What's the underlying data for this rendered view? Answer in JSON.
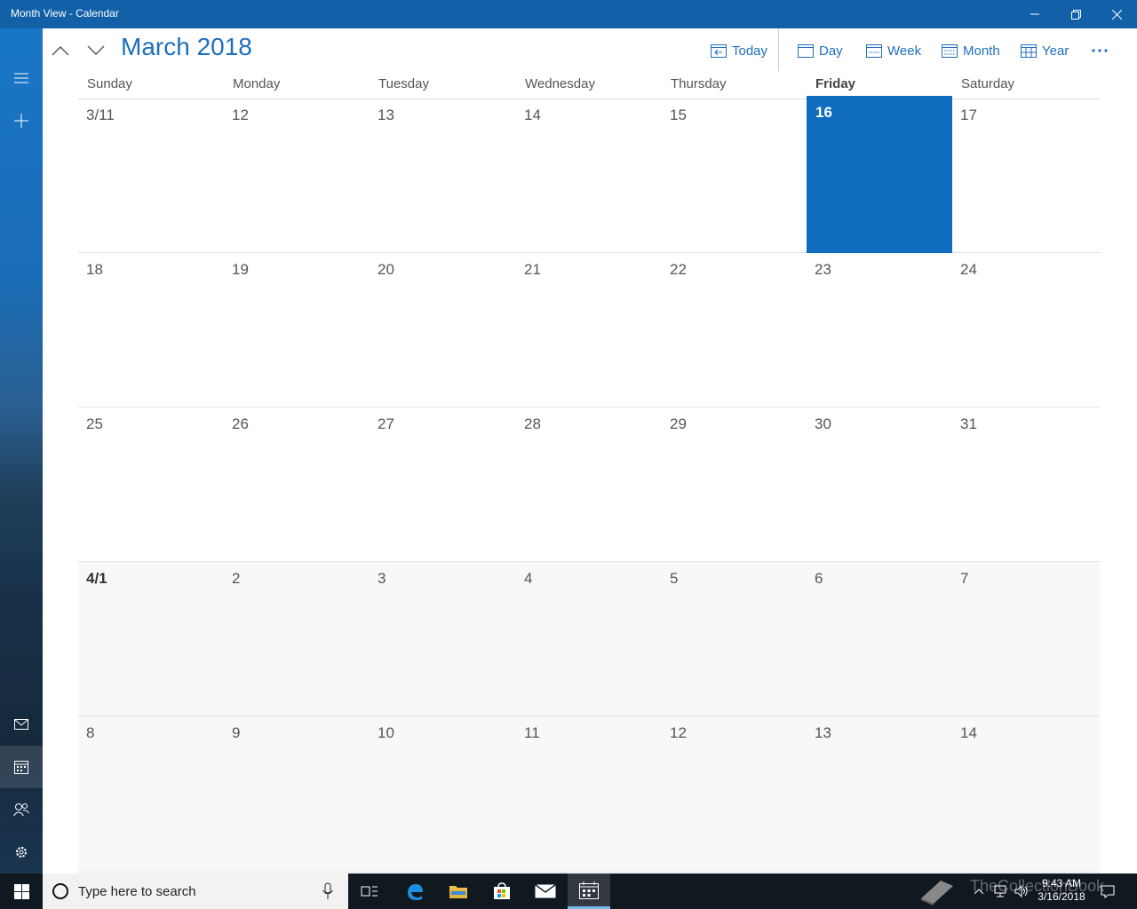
{
  "window": {
    "title": "Month View - Calendar"
  },
  "header": {
    "month_title": "March 2018",
    "views": {
      "today": "Today",
      "day": "Day",
      "week": "Week",
      "month": "Month",
      "year": "Year"
    }
  },
  "weekdays": [
    "Sunday",
    "Monday",
    "Tuesday",
    "Wednesday",
    "Thursday",
    "Friday",
    "Saturday"
  ],
  "today_weekday_index": 5,
  "weeks": [
    [
      "3/11",
      "12",
      "13",
      "14",
      "15",
      "16",
      "17"
    ],
    [
      "18",
      "19",
      "20",
      "21",
      "22",
      "23",
      "24"
    ],
    [
      "25",
      "26",
      "27",
      "28",
      "29",
      "30",
      "31"
    ],
    [
      "4/1",
      "2",
      "3",
      "4",
      "5",
      "6",
      "7"
    ],
    [
      "8",
      "9",
      "10",
      "11",
      "12",
      "13",
      "14"
    ]
  ],
  "today_cell": {
    "week": 0,
    "day": 5
  },
  "next_month_start_week": 3,
  "taskbar": {
    "search_placeholder": "Type here to search",
    "time": "9:43 AM",
    "date": "3/16/2018",
    "watermark": "TheCollectionBook"
  },
  "colors": {
    "accent": "#1f6fbd",
    "today_fill": "#0f6cbf",
    "titlebar": "#1160a8",
    "taskbar": "#101820"
  }
}
